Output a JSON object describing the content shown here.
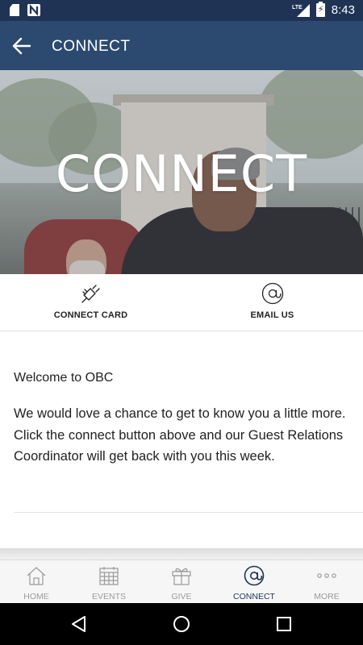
{
  "status_bar": {
    "time": "8:43",
    "network": "LTE",
    "icons": [
      "sd-card-icon",
      "notification-n-icon",
      "lte-signal-icon",
      "battery-charging-icon"
    ]
  },
  "app_bar": {
    "title": "CONNECT",
    "back_icon": "arrow-left-icon"
  },
  "hero": {
    "title": "CONNECT"
  },
  "actions": [
    {
      "label": "CONNECT CARD",
      "icon": "plug-icon"
    },
    {
      "label": "EMAIL US",
      "icon": "at-sign-icon"
    }
  ],
  "content": {
    "heading": "Welcome to OBC",
    "body": "We would love a chance to get to know you a little more.  Click the connect button above and our Guest Relations Coordinator will get back with you this week."
  },
  "tabs": [
    {
      "label": "HOME",
      "icon": "home-icon",
      "active": false
    },
    {
      "label": "EVENTS",
      "icon": "calendar-icon",
      "active": false
    },
    {
      "label": "GIVE",
      "icon": "gift-icon",
      "active": false
    },
    {
      "label": "CONNECT",
      "icon": "at-sign-icon",
      "active": true
    },
    {
      "label": "MORE",
      "icon": "more-dots-icon",
      "active": false
    }
  ],
  "colors": {
    "status_bar": "#1f3354",
    "app_bar": "#2c4a6f",
    "active_tab": "#1f3354",
    "inactive_tab": "#9a9a9a"
  },
  "nav_bar": {
    "icons": [
      "back-triangle-icon",
      "home-circle-icon",
      "recents-square-icon"
    ]
  }
}
